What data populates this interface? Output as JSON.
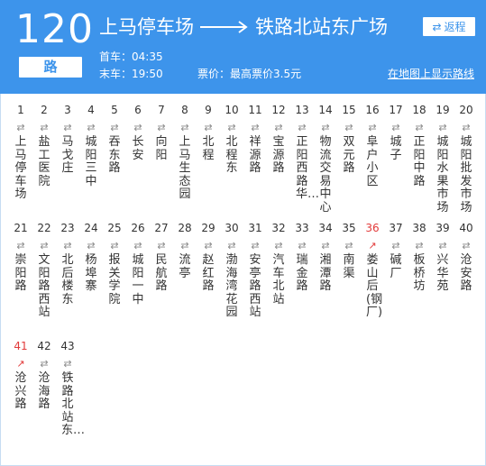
{
  "route": {
    "number": "120",
    "unit": "路"
  },
  "title": {
    "from": "上马停车场",
    "to": "铁路北站东广场"
  },
  "reverse_button": {
    "icon": "⇄",
    "label": "返程"
  },
  "first_bus": "首车：04:35",
  "last_bus": "末车：19:50",
  "fare": "票价：最高票价3.5元",
  "map_link": "在地图上显示路线",
  "colors": {
    "header": "#3d94eb",
    "highlight": "#e23b3b"
  },
  "stops": [
    {
      "num": "1",
      "dir": "⇄",
      "name": "上马停车场",
      "highlight": false
    },
    {
      "num": "2",
      "dir": "⇄",
      "name": "盐工医院",
      "highlight": false
    },
    {
      "num": "3",
      "dir": "⇄",
      "name": "马戈庄",
      "highlight": false
    },
    {
      "num": "4",
      "dir": "⇄",
      "name": "城阳三中",
      "highlight": false
    },
    {
      "num": "5",
      "dir": "⇄",
      "name": "吞东路",
      "highlight": false
    },
    {
      "num": "6",
      "dir": "⇄",
      "name": "长安",
      "highlight": false
    },
    {
      "num": "7",
      "dir": "⇄",
      "name": "向阳",
      "highlight": false
    },
    {
      "num": "8",
      "dir": "⇄",
      "name": "上马生态园",
      "highlight": false
    },
    {
      "num": "9",
      "dir": "⇄",
      "name": "北程",
      "highlight": false
    },
    {
      "num": "10",
      "dir": "⇄",
      "name": "北程东",
      "highlight": false
    },
    {
      "num": "11",
      "dir": "⇄",
      "name": "祥源路",
      "highlight": false
    },
    {
      "num": "12",
      "dir": "⇄",
      "name": "宝源路",
      "highlight": false
    },
    {
      "num": "13",
      "dir": "⇄",
      "name": "正阳西路华…",
      "highlight": false
    },
    {
      "num": "14",
      "dir": "⇄",
      "name": "物流交易中心",
      "highlight": false
    },
    {
      "num": "15",
      "dir": "⇄",
      "name": "双元路",
      "highlight": false
    },
    {
      "num": "16",
      "dir": "⇄",
      "name": "阜户小区",
      "highlight": false
    },
    {
      "num": "17",
      "dir": "⇄",
      "name": "城子",
      "highlight": false
    },
    {
      "num": "18",
      "dir": "⇄",
      "name": "正阳中路",
      "highlight": false
    },
    {
      "num": "19",
      "dir": "⇄",
      "name": "城阳水果市场",
      "highlight": false
    },
    {
      "num": "20",
      "dir": "⇄",
      "name": "城阳批发市场",
      "highlight": false
    },
    {
      "num": "21",
      "dir": "⇄",
      "name": "崇阳路",
      "highlight": false
    },
    {
      "num": "22",
      "dir": "⇄",
      "name": "文阳路西站",
      "highlight": false
    },
    {
      "num": "23",
      "dir": "⇄",
      "name": "北后楼东",
      "highlight": false
    },
    {
      "num": "24",
      "dir": "⇄",
      "name": "杨埠寨",
      "highlight": false
    },
    {
      "num": "25",
      "dir": "⇄",
      "name": "报关学院",
      "highlight": false
    },
    {
      "num": "26",
      "dir": "⇄",
      "name": "城阳一中",
      "highlight": false
    },
    {
      "num": "27",
      "dir": "⇄",
      "name": "民航路",
      "highlight": false
    },
    {
      "num": "28",
      "dir": "⇄",
      "name": "流亭",
      "highlight": false
    },
    {
      "num": "29",
      "dir": "⇄",
      "name": "赵红路",
      "highlight": false
    },
    {
      "num": "30",
      "dir": "⇄",
      "name": "渤海湾花园",
      "highlight": false
    },
    {
      "num": "31",
      "dir": "⇄",
      "name": "安亭路西站",
      "highlight": false
    },
    {
      "num": "32",
      "dir": "⇄",
      "name": "汽车北站",
      "highlight": false
    },
    {
      "num": "33",
      "dir": "⇄",
      "name": "瑞金路",
      "highlight": false
    },
    {
      "num": "34",
      "dir": "⇄",
      "name": "湘潭路",
      "highlight": false
    },
    {
      "num": "35",
      "dir": "⇄",
      "name": "南渠",
      "highlight": false
    },
    {
      "num": "36",
      "dir": "↗",
      "name": "娄山后(钢厂)",
      "highlight": true
    },
    {
      "num": "37",
      "dir": "⇄",
      "name": "碱厂",
      "highlight": false
    },
    {
      "num": "38",
      "dir": "⇄",
      "name": "板桥坊",
      "highlight": false
    },
    {
      "num": "39",
      "dir": "⇄",
      "name": "兴华苑",
      "highlight": false
    },
    {
      "num": "40",
      "dir": "⇄",
      "name": "沧安路",
      "highlight": false
    },
    {
      "num": "41",
      "dir": "↗",
      "name": "沧兴路",
      "highlight": true
    },
    {
      "num": "42",
      "dir": "⇄",
      "name": "沧海路",
      "highlight": false
    },
    {
      "num": "43",
      "dir": "⇄",
      "name": "铁路北站东…",
      "highlight": false
    }
  ]
}
